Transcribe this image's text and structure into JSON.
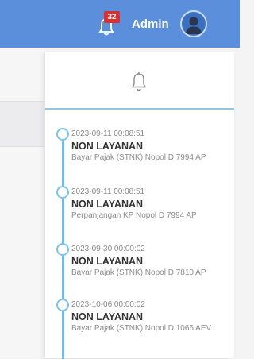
{
  "topbar": {
    "notification_count": "32",
    "user_name": "Admin"
  },
  "colors": {
    "topbar": "#5b8fdb",
    "badge": "#d9302f",
    "timeline": "#6fbde9"
  },
  "icons": {
    "topbar_bell": "bell-icon",
    "avatar": "user-avatar-icon",
    "dropdown_bell": "bell-outline-icon"
  },
  "notifications": [
    {
      "timestamp": "2023-09-11 00:08:51",
      "title": "NON LAYANAN",
      "description": "Bayar Pajak (STNK) Nopol D 7994 AP"
    },
    {
      "timestamp": "2023-09-11 00:08:51",
      "title": "NON LAYANAN",
      "description": "Perpanjangan KP Nopol D 7994 AP"
    },
    {
      "timestamp": "2023-09-30 00:00:02",
      "title": "NON LAYANAN",
      "description": "Bayar Pajak (STNK) Nopol D 7810 AP"
    },
    {
      "timestamp": "2023-10-06 00:00:02",
      "title": "NON LAYANAN",
      "description": "Bayar Pajak (STNK) Nopol D 1066 AEV"
    }
  ]
}
